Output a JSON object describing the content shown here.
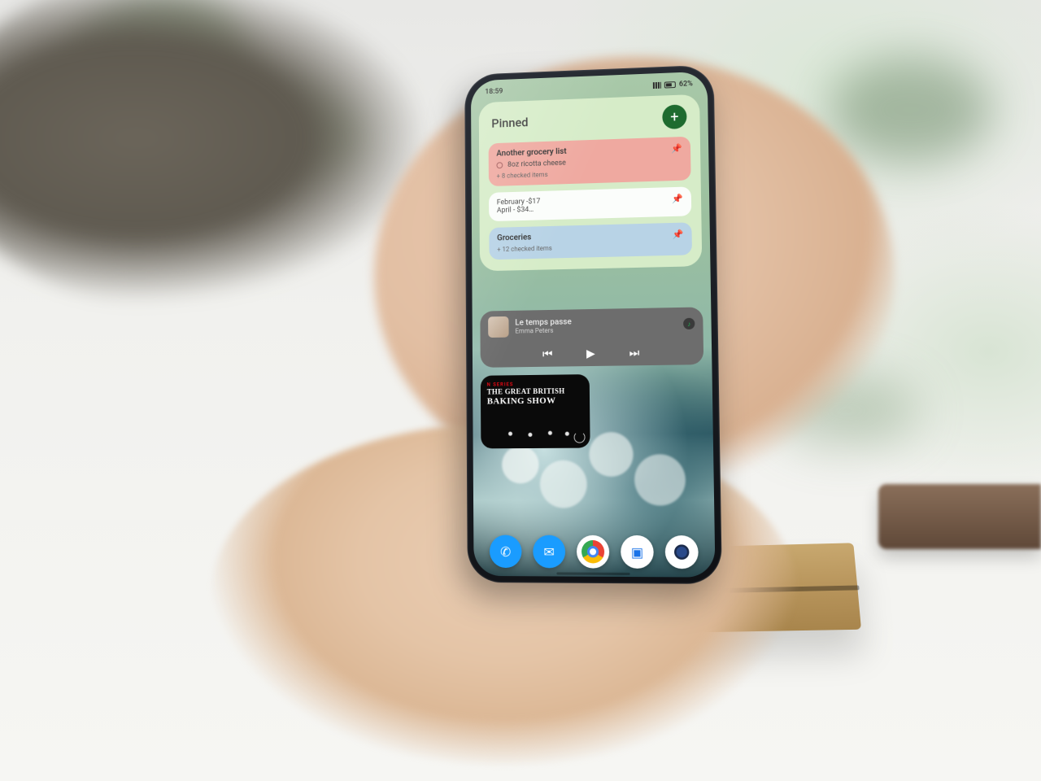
{
  "status": {
    "time": "18:59",
    "battery": "62%"
  },
  "pinned": {
    "title": "Pinned",
    "cards": [
      {
        "title": "Another grocery list",
        "line": "8oz ricotta cheese",
        "sub": "+ 8 checked items"
      },
      {
        "line1": "February -$17",
        "line2": "April - $34…"
      },
      {
        "title": "Groceries",
        "sub": "+ 12 checked items"
      }
    ]
  },
  "music": {
    "song": "Le temps passe",
    "artist": "Emma Peters"
  },
  "netflix": {
    "tag": "N SERIES",
    "line1": "THE GREAT BRITISH",
    "line2": "BAKING SHOW"
  }
}
